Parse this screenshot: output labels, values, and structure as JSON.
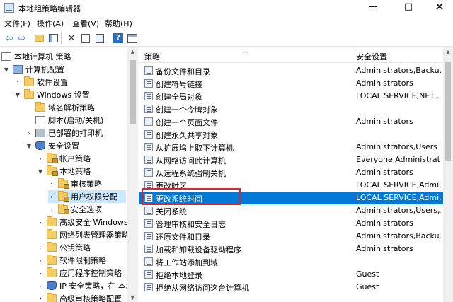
{
  "window": {
    "title": "本地组策略编辑器",
    "minimize": "—",
    "maximize": "□",
    "close": "✕"
  },
  "menu": [
    "文件(F)",
    "操作(A)",
    "查看(V)",
    "帮助(H)"
  ],
  "toolbar_icons": [
    "back-icon",
    "forward-icon",
    "up-folder-icon",
    "show-tree-icon",
    "delete-icon",
    "properties-icon",
    "export-icon",
    "help-icon",
    "console-icon"
  ],
  "tree": [
    {
      "label": "本地计算机 策略",
      "icon": "policy-icon",
      "expander": ""
    },
    {
      "label": "计算机配置",
      "icon": "computer-icon",
      "expander": "▼"
    },
    {
      "label": "软件设置",
      "icon": "folder-icon",
      "expander": "›"
    },
    {
      "label": "Windows 设置",
      "icon": "folder-icon",
      "expander": "▼"
    },
    {
      "label": "域名解析策略",
      "icon": "folder-icon",
      "expander": ""
    },
    {
      "label": "脚本(启动/关机)",
      "icon": "script-icon",
      "expander": ""
    },
    {
      "label": "已部署的打印机",
      "icon": "printer-icon",
      "expander": "›"
    },
    {
      "label": "安全设置",
      "icon": "shield-icon",
      "expander": "▼"
    },
    {
      "label": "帐户策略",
      "icon": "folder-lock-icon",
      "expander": "›"
    },
    {
      "label": "本地策略",
      "icon": "folder-lock-icon",
      "expander": "▼"
    },
    {
      "label": "审核策略",
      "icon": "folder-lock-icon",
      "expander": "›"
    },
    {
      "label": "用户权限分配",
      "icon": "folder-lock-icon",
      "expander": "›"
    },
    {
      "label": "安全选项",
      "icon": "folder-lock-icon",
      "expander": "›"
    },
    {
      "label": "高级安全 Windows",
      "icon": "folder-icon",
      "expander": "›"
    },
    {
      "label": "网络列表管理器策略",
      "icon": "folder-icon",
      "expander": ""
    },
    {
      "label": "公钥策略",
      "icon": "folder-icon",
      "expander": "›"
    },
    {
      "label": "软件限制策略",
      "icon": "folder-icon",
      "expander": "›"
    },
    {
      "label": "应用程序控制策略",
      "icon": "folder-icon",
      "expander": "›"
    },
    {
      "label": "IP 安全策略，在 本地",
      "icon": "shield-icon",
      "expander": "›"
    },
    {
      "label": "高级审核策略配置",
      "icon": "folder-icon",
      "expander": "›"
    }
  ],
  "list": {
    "columns": [
      "策略",
      "安全设置"
    ],
    "rows": [
      {
        "name": "备份文件和目录",
        "value": "Administrators,Backu..."
      },
      {
        "name": "创建符号链接",
        "value": "Administrators"
      },
      {
        "name": "创建全局对象",
        "value": "LOCAL SERVICE,NET..."
      },
      {
        "name": "创建一个令牌对象",
        "value": ""
      },
      {
        "name": "创建一个页面文件",
        "value": "Administrators"
      },
      {
        "name": "创建永久共享对象",
        "value": ""
      },
      {
        "name": "从扩展坞上取下计算机",
        "value": "Administrators,Users"
      },
      {
        "name": "从网络访问此计算机",
        "value": "Everyone,Administrat..."
      },
      {
        "name": "从远程系统强制关机",
        "value": "Administrators"
      },
      {
        "name": "更改时区",
        "value": "LOCAL SERVICE,Admi..."
      },
      {
        "name": "更改系统时间",
        "value": "LOCAL SERVICE,Admi..."
      },
      {
        "name": "关闭系统",
        "value": "Administrators,Users,..."
      },
      {
        "name": "管理审核和安全日志",
        "value": "Administrators"
      },
      {
        "name": "还原文件和目录",
        "value": "Administrators,Backu..."
      },
      {
        "name": "加载和卸载设备驱动程序",
        "value": "Administrators"
      },
      {
        "name": "将工作站添加到域",
        "value": ""
      },
      {
        "name": "拒绝本地登录",
        "value": "Guest"
      },
      {
        "name": "拒绝从网络访问这台计算机",
        "value": "Guest"
      }
    ],
    "selected_index": 10
  },
  "colors": {
    "selection": "#0078d7",
    "highlight_box": "#e0242b",
    "tree_selection": "#cce8ff"
  }
}
